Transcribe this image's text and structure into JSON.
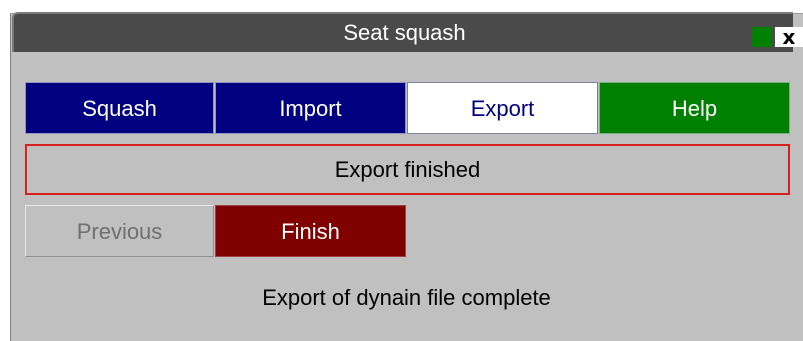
{
  "window": {
    "title": "Seat squash",
    "close_glyph": "x",
    "status_color": "#008000"
  },
  "tabs": [
    {
      "label": "Squash",
      "state": "inactive"
    },
    {
      "label": "Import",
      "state": "inactive"
    },
    {
      "label": "Export",
      "state": "active"
    },
    {
      "label": "Help",
      "state": "help"
    }
  ],
  "status": {
    "text": "Export finished",
    "border_color": "#d82020"
  },
  "buttons": {
    "previous_label": "Previous",
    "previous_enabled": false,
    "finish_label": "Finish"
  },
  "message": "Export of dynain file complete",
  "colors": {
    "tab_inactive": "#000080",
    "tab_help": "#008000",
    "finish": "#800000",
    "panel": "#c0c0c0"
  }
}
